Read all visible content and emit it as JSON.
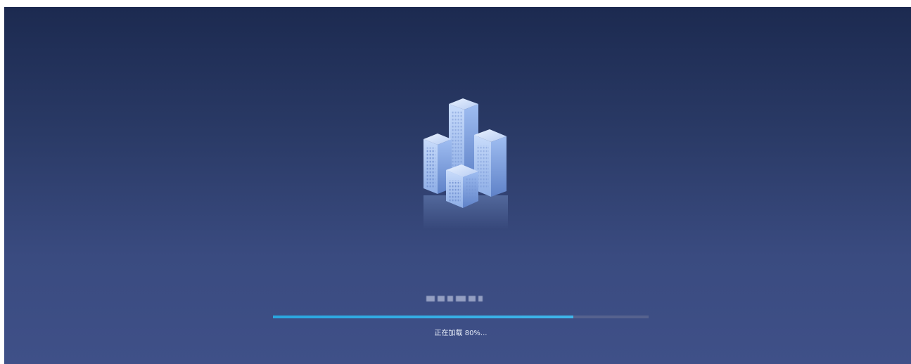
{
  "loading": {
    "status_text": "正在加载",
    "percent_text": "80%...",
    "progress": 0.8
  },
  "colors": {
    "background_top": "#1c2a50",
    "background_bottom": "#3f5088",
    "progress_fill": "#2aa7e0",
    "progress_track": "#56628e"
  },
  "icons": {
    "logo": "city-buildings-icon"
  }
}
